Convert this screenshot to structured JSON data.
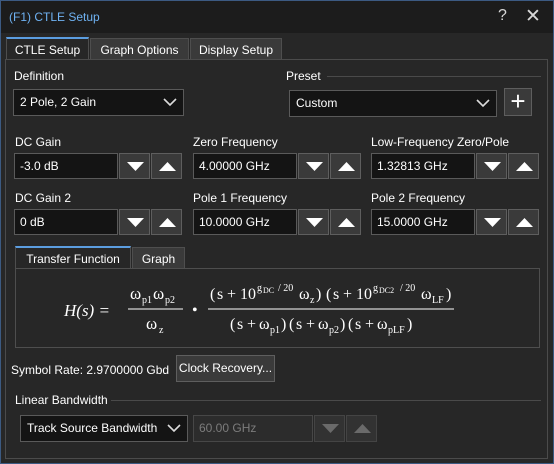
{
  "window": {
    "title": "(F1) CTLE Setup",
    "help_glyph": "?",
    "close_glyph": "✕"
  },
  "tabs": [
    {
      "label": "CTLE Setup",
      "active": true
    },
    {
      "label": "Graph Options",
      "active": false
    },
    {
      "label": "Display Setup",
      "active": false
    }
  ],
  "definition": {
    "label": "Definition",
    "value": "2 Pole, 2 Gain"
  },
  "preset": {
    "label": "Preset",
    "value": "Custom",
    "add_glyph": "+"
  },
  "params": {
    "dc_gain": {
      "label": "DC Gain",
      "value": "-3.0 dB"
    },
    "zero_frequency": {
      "label": "Zero Frequency",
      "value": "4.00000 GHz"
    },
    "lf_zero_pole": {
      "label": "Low-Frequency Zero/Pole",
      "value": "1.32813 GHz"
    },
    "dc_gain_2": {
      "label": "DC Gain 2",
      "value": "0 dB"
    },
    "pole1_frequency": {
      "label": "Pole 1 Frequency",
      "value": "10.0000 GHz"
    },
    "pole2_frequency": {
      "label": "Pole 2 Frequency",
      "value": "15.0000 GHz"
    }
  },
  "subtabs": [
    {
      "label": "Transfer Function",
      "active": true
    },
    {
      "label": "Graph",
      "active": false
    }
  ],
  "formula": {
    "lhs": "H(s) =",
    "w": "ω",
    "s": "s",
    "ten": "10",
    "dot": "•",
    "eq_plus": "+",
    "p1": "p1",
    "p2": "p2",
    "z": "z",
    "lf": "LF",
    "plf": "pLF",
    "gdc": "g",
    "dc": "DC",
    "dc2": "DC2",
    "div20": "/ 20",
    "lp": "(",
    "rp": ")"
  },
  "symbol_rate": {
    "label": "Symbol Rate: 2.9700000 Gbd"
  },
  "clock_recovery_button": "Clock Recovery...",
  "linear_bandwidth": {
    "label": "Linear Bandwidth",
    "mode": "Track Source Bandwidth",
    "value": "60.00 GHz"
  },
  "colors": {
    "accent": "#5b9de0",
    "title": "#6fb2f2"
  }
}
